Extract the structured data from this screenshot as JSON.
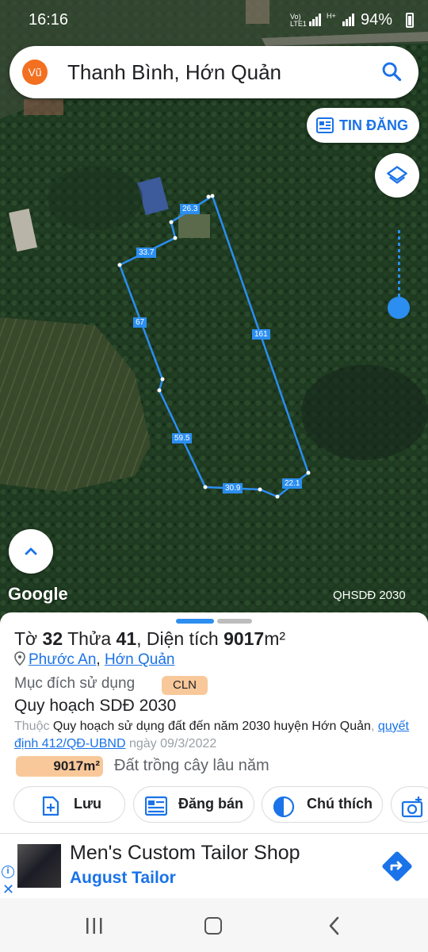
{
  "status_bar": {
    "time": "16:16",
    "network_label_top": "Vo)",
    "network_label_bottom": "LTE1",
    "signal2_label": "H+",
    "battery": "94%"
  },
  "search": {
    "avatar_text": "Vũ",
    "query": "Thanh Bình, Hớn Quản",
    "icon": "search-icon"
  },
  "map": {
    "post_button_label": "TIN ĐĂNG",
    "layers_icon": "layers-icon",
    "brand": "Google",
    "layer_name": "QHSDĐ 2030",
    "parcel_edges": [
      "26.3",
      "33.7",
      "67",
      "161",
      "59.5",
      "30.9",
      "22.1"
    ],
    "parcel_color": "#2b8ef0"
  },
  "sheet": {
    "title_prefix": "Tờ ",
    "sheet_no": "32",
    "title_mid": " Thửa ",
    "lot_no": "41",
    "title_area_label": ", Diện tích ",
    "area": "9017",
    "area_unit": "m²",
    "location_ward": "Phước An",
    "location_sep": ", ",
    "location_district": "Hớn Quản",
    "purpose_label": "Mục đích sử dụng",
    "purpose_code": "CLN",
    "plan_title": "Quy hoạch SDĐ 2030",
    "plan_prefix": "Thuộc",
    "plan_text": " Quy hoạch sử dụng đất đến năm 2030 huyện Hớn Quản",
    "plan_comma": ", ",
    "decision_link": "quyết định 412/QĐ-UBND",
    "decision_date": " ngày 09/3/2022",
    "area_badge": "9017m²",
    "land_type": "Đất trồng cây lâu năm",
    "actions": {
      "save": "Lưu",
      "sell": "Đăng bán",
      "legend": "Chú thích"
    }
  },
  "ad": {
    "title": "Men's Custom Tailor Shop",
    "advertiser": "August Tailor",
    "info_glyph": "i",
    "close_glyph": "✕"
  },
  "colors": {
    "accent": "#1a73e8",
    "badge": "#f9c89a",
    "avatar": "#f37021"
  }
}
